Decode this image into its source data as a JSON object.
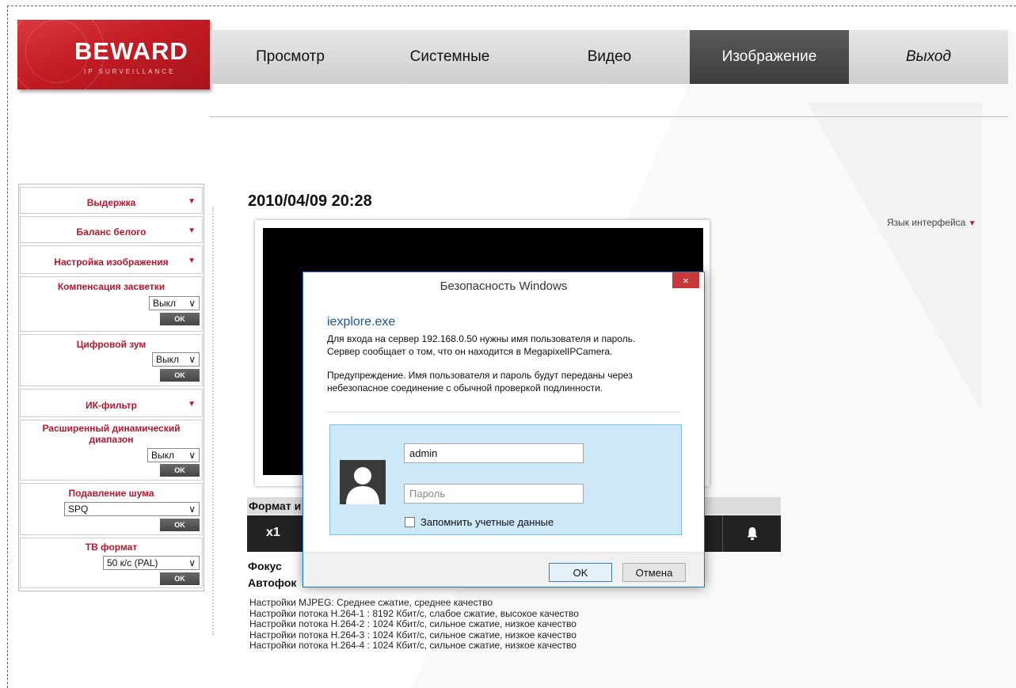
{
  "logo": {
    "brand": "BEWARD",
    "tagline": "IP SURVEILLANCE"
  },
  "nav": {
    "items": [
      {
        "label": "Просмотр",
        "active": false
      },
      {
        "label": "Системные",
        "active": false
      },
      {
        "label": "Видео",
        "active": false
      },
      {
        "label": "Изображение",
        "active": true
      },
      {
        "label": "Выход",
        "active": false
      }
    ]
  },
  "sidebar": {
    "exposure": "Выдержка",
    "white_balance": "Баланс белого",
    "image_settings": "Настройка изображения",
    "backlight": {
      "title": "Компенсация засветки",
      "value": "Выкл",
      "ok": "OK"
    },
    "digital_zoom": {
      "title": "Цифровой зум",
      "value": "Выкл",
      "ok": "OK"
    },
    "ir_filter": "ИК-фильтр",
    "wdr": {
      "title_line1": "Расширенный динамический",
      "title_line2": "диапазон",
      "value": "Выкл",
      "ok": "OK"
    },
    "noise": {
      "title": "Подавление шума",
      "value": "SPQ",
      "ok": "OK"
    },
    "tv_format": {
      "title": "ТВ формат",
      "value": "50 к/с (PAL)",
      "ok": "OK"
    }
  },
  "main": {
    "datetime": "2010/04/09 20:28",
    "language": "Язык интерфейса",
    "format_label": "Формат и",
    "zoom_label": "x1",
    "focus_label": "Фокус",
    "autofocus_label": "Автофок",
    "streams": [
      "Настройки MJPEG: Среднее сжатие, среднее качество",
      "Настройки потока H.264-1 : 8192 Кбит/с, слабое сжатие, высокое качество",
      "Настройки потока H.264-2 : 1024 Кбит/с, сильное сжатие, низкое качество",
      "Настройки потока H.264-3 : 1024 Кбит/с, сильное сжатие, низкое качество",
      "Настройки потока H.264-4 : 1024 Кбит/с, сильное сжатие, низкое качество"
    ]
  },
  "dialog": {
    "title": "Безопасность Windows",
    "close": "×",
    "app": "iexplore.exe",
    "line1": "Для входа на сервер 192.168.0.50 нужны имя пользователя и пароль.",
    "line2": "Сервер сообщает о том, что он находится в MegapixelIPCamera.",
    "line3": "Предупреждение. Имя пользователя и пароль будут переданы через",
    "line4": "небезопасное соединение с обычной проверкой подлинности.",
    "username": "admin",
    "password_placeholder": "Пароль",
    "remember": "Запомнить учетные данные",
    "ok": "OK",
    "cancel": "Отмена"
  },
  "colors": {
    "accent_red": "#c0162b",
    "logo_red": "#c31c24",
    "dialog_blue": "#1979ca"
  }
}
